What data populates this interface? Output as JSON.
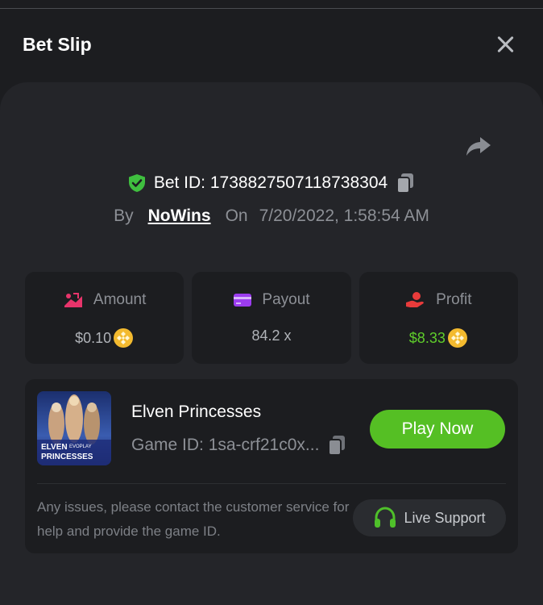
{
  "header": {
    "title": "Bet Slip"
  },
  "bet": {
    "id_text": "Bet ID: 1738827507118738304",
    "by_label": "By",
    "user": "NoWins",
    "on_label": "On",
    "datetime": "7/20/2022, 1:58:54 AM"
  },
  "stats": {
    "amount_label": "Amount",
    "amount_value": "$0.10",
    "payout_label": "Payout",
    "payout_value": "84.2 x",
    "profit_label": "Profit",
    "profit_value": "$8.33"
  },
  "game": {
    "name": "Elven Princesses",
    "id_text": "Game ID: 1sa-crf21c0x...",
    "thumb_title_1": "ELVEN",
    "thumb_title_2": "PRINCESSES",
    "thumb_brand": "EVOPLAY",
    "play_label": "Play Now",
    "issues_text": "Any issues, please contact the customer service for help and provide the game ID.",
    "support_label": "Live Support"
  },
  "colors": {
    "background": "#1c1d20",
    "panel": "#242529",
    "accent_green": "#55bf24",
    "profit_green": "#5fcd2b",
    "muted_text": "#8d9096"
  },
  "icons": [
    "close-icon",
    "share-icon",
    "shield-check-icon",
    "copy-icon",
    "amount-icon",
    "payout-card-icon",
    "profit-hand-icon",
    "coin-icon",
    "headset-icon"
  ]
}
